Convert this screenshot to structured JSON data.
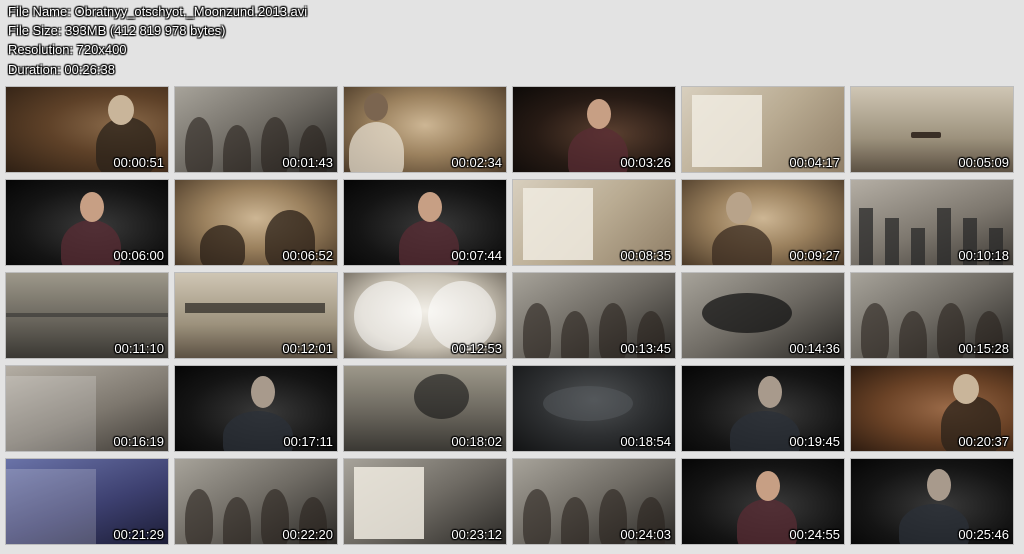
{
  "info": {
    "file_name": "File Name: Obratnyy_otschyot._Moonzund.2013.avi",
    "file_size": "File Size: 393MB (412 819 978 bytes)",
    "resolution": "Resolution: 720x400",
    "duration": "Duration: 00:26:38"
  },
  "thumbnails": [
    {
      "time": "00:00:51",
      "scene": "scene-brown",
      "figure": "man-right"
    },
    {
      "time": "00:01:43",
      "scene": "scene-bw",
      "figure": "crowd"
    },
    {
      "time": "00:02:34",
      "scene": "scene-sepia",
      "figure": "man-left"
    },
    {
      "time": "00:03:26",
      "scene": "scene-dark",
      "figure": "man-center"
    },
    {
      "time": "00:04:17",
      "scene": "scene-paper",
      "figure": "document"
    },
    {
      "time": "00:05:09",
      "scene": "scene-sky",
      "figure": "plane"
    },
    {
      "time": "00:06:00",
      "scene": "scene-black",
      "figure": "man-center"
    },
    {
      "time": "00:06:52",
      "scene": "scene-sepia",
      "figure": "sailors"
    },
    {
      "time": "00:07:44",
      "scene": "scene-black",
      "figure": "man-center"
    },
    {
      "time": "00:08:35",
      "scene": "scene-paper",
      "figure": "document"
    },
    {
      "time": "00:09:27",
      "scene": "scene-sepia",
      "figure": "woman"
    },
    {
      "time": "00:10:18",
      "scene": "scene-gray",
      "figure": "city"
    },
    {
      "time": "00:11:10",
      "scene": "scene-sea",
      "figure": "sea"
    },
    {
      "time": "00:12:01",
      "scene": "scene-sky",
      "figure": "ships"
    },
    {
      "time": "00:12:53",
      "scene": "scene-white",
      "figure": "binocular"
    },
    {
      "time": "00:13:45",
      "scene": "scene-bw",
      "figure": "crowd"
    },
    {
      "time": "00:14:36",
      "scene": "scene-bw",
      "figure": "gun"
    },
    {
      "time": "00:15:28",
      "scene": "scene-bw",
      "figure": "crowd"
    },
    {
      "time": "00:16:19",
      "scene": "scene-gray",
      "figure": "wall"
    },
    {
      "time": "00:17:11",
      "scene": "scene-black",
      "figure": "old-man"
    },
    {
      "time": "00:18:02",
      "scene": "scene-sea",
      "figure": "explosion"
    },
    {
      "time": "00:18:54",
      "scene": "scene-storm",
      "figure": "sky"
    },
    {
      "time": "00:19:45",
      "scene": "scene-black",
      "figure": "old-man"
    },
    {
      "time": "00:20:37",
      "scene": "scene-rust",
      "figure": "man-right"
    },
    {
      "time": "00:21:29",
      "scene": "scene-blue",
      "figure": "wall"
    },
    {
      "time": "00:22:20",
      "scene": "scene-bw",
      "figure": "crowd"
    },
    {
      "time": "00:23:12",
      "scene": "scene-bw",
      "figure": "document"
    },
    {
      "time": "00:24:03",
      "scene": "scene-bw",
      "figure": "crowd"
    },
    {
      "time": "00:24:55",
      "scene": "scene-black",
      "figure": "man-center"
    },
    {
      "time": "00:25:46",
      "scene": "scene-black",
      "figure": "old-man"
    }
  ]
}
